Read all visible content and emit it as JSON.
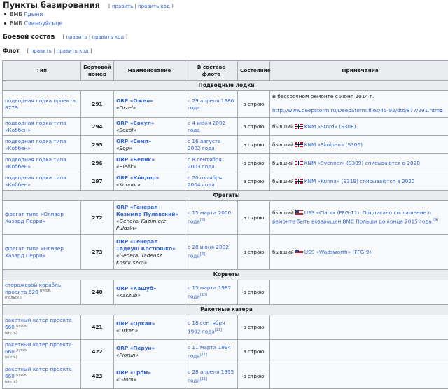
{
  "edit_label": "править",
  "edit_code_label": "править код",
  "section_bases": {
    "title": "Пункты базирования"
  },
  "bases": [
    {
      "prefix": "ВМБ",
      "link": "Гдыня"
    },
    {
      "prefix": "ВМБ",
      "link": "Свиноуйсьце"
    }
  ],
  "section_combat": {
    "title": "Боевой состав"
  },
  "section_fleet": {
    "title": "Флот"
  },
  "headers": {
    "type": "Тип",
    "board": "Бортовой номер",
    "name": "Наименование",
    "since": "В составе флота",
    "state": "Состояние",
    "notes": "Примечания"
  },
  "groups": {
    "subs": "Подводные лодки",
    "frigates": "Фрегаты",
    "corvettes": "Корветы",
    "missile": "Ракетные катера"
  },
  "rows": [
    {
      "type": "подводная лодка проекта 877Э",
      "num": "291",
      "name": "ORP «Ожел»",
      "latin": "«Orzeł»",
      "since": "с 29 апреля 1986 года",
      "state": "в строю",
      "note1": "В бессрочном ремонте с июня 2014 г.",
      "note2": "http://www.deepstorm.ru/DeepStorm.files/45-92/dts/877/291.htm"
    },
    {
      "type": "подводная лодка типа «Коббен»",
      "num": "294",
      "name": "ORP «Сокул»",
      "latin": "«Sokół»",
      "since": "с 4 июня 2002 года",
      "state": "в строю",
      "note_pre": "бывший",
      "note_post": "KNM «Stord» (S308)"
    },
    {
      "type": "подводная лодка типа «Коббен»",
      "num": "295",
      "name": "ORP «Семп»",
      "latin": "«Sęp»",
      "since": "с 16 августа 2002 года",
      "state": "в строю",
      "note_pre": "бывший",
      "note_post": "KNM «Skolpen» (S306)"
    },
    {
      "type": "подводная лодка типа «Коббен»",
      "num": "296",
      "name": "ORP «Белик»",
      "latin": "«Bielik»",
      "since": "с 8 сентября 2003 года",
      "state": "в строю",
      "note_pre": "бывший",
      "note_post": "KNM «Svenner» (S309) списываются в 2020"
    },
    {
      "type": "подводная лодка типа «Коббен»",
      "num": "297",
      "name": "ORP «Ко́ндор»",
      "latin": "«Kondor»",
      "since": "с 20 октября 2004 года",
      "state": "в строю",
      "note_pre": "бывший",
      "note_post": "KNM «Kunna» (S319) списываются в 2020"
    },
    {
      "type": "фрегат типа «Оливер Хазард Перри»",
      "num": "272",
      "name": "ORP «Генерал Казимир Пулавский»",
      "latin": "«General Kazimierz Pułaski»",
      "since": "с 15 марта 2000 года",
      "ref": "[8]",
      "state": "в строю",
      "note_pre": "бывший",
      "note_post": "USS «Clark» (FFG-11). Подписано соглашение о ремонте быть возвращен ВМС Польши до конца 2015 года.",
      "note_ref": "[9]"
    },
    {
      "type": "фрегат типа «Оливер Хазард Перри»",
      "num": "273",
      "name": "ORP «Генерал Тадеуш Костюшко»",
      "latin": "«General Tadeusz Kościuszko»",
      "since": "с 28 июня 2002 года",
      "ref": "[8]",
      "state": "в строю",
      "note_pre": "бывший",
      "note_post": "USS «Wadsworth» (FFG-9)"
    },
    {
      "type": "сторожевой корабль проекта 620",
      "tag1": "(польск.)",
      "tag2": "русск.",
      "num": "240",
      "name": "ORP «Кашуб»",
      "latin": "«Kaszub»",
      "since": "с 15 марта 1987 года",
      "ref": "[10]",
      "state": "в строю"
    },
    {
      "type": "ракетный катер проекта 660",
      "tag1": "(англ.)",
      "tag2": "русск.",
      "num": "421",
      "name": "ORP «Оркан»",
      "latin": "«Orkan»",
      "since": "с 18 сентября 1992 года",
      "ref": "[11]",
      "state": "в строю"
    },
    {
      "type": "ракетный катер проекта 660",
      "tag1": "(англ.)",
      "tag2": "русск.",
      "num": "422",
      "name": "ORP «Пёрун»",
      "latin": "«Piorun»",
      "since": "с 11 марта 1994 года",
      "ref": "[11]",
      "state": "в строю"
    },
    {
      "type": "ракетный катер проекта 660",
      "tag1": "(англ.)",
      "tag2": "русск.",
      "num": "423",
      "name": "ORP «Гро́м»",
      "latin": "«Grom»",
      "since": "с 28 апреля 1995 года",
      "ref": "[11]",
      "state": "в строю"
    }
  ],
  "colors": {
    "link": "#3366cc",
    "header_bg": "#eaecf0",
    "border": "#a2a9b1"
  },
  "icons": {
    "norway_flag": "norway-flag-icon",
    "us_flag": "us-flag-icon",
    "external_link": "external-link-icon"
  }
}
